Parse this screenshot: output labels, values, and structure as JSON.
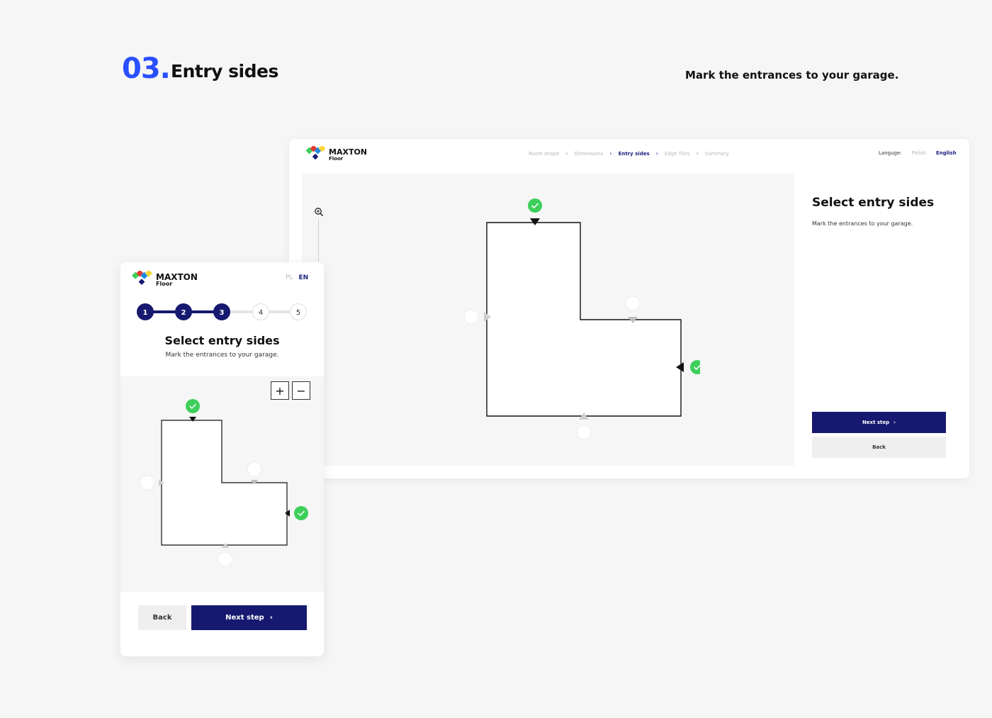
{
  "section": {
    "number": "03.",
    "title": "Entry sides",
    "subtitle": "Mark the entrances to your garage."
  },
  "brand": {
    "name": "MAXTON",
    "sub": "Floor"
  },
  "desktop": {
    "breadcrumbs": [
      {
        "label": "Room shape",
        "state": "done"
      },
      {
        "label": "Dimensions",
        "state": "done"
      },
      {
        "label": "Entry sides",
        "state": "active"
      },
      {
        "label": "Edge Tiles",
        "state": "upcoming"
      },
      {
        "label": "Summary",
        "state": "upcoming"
      }
    ],
    "language": {
      "label": "Languge:",
      "options": [
        "Polish",
        "English"
      ],
      "selected": "English"
    },
    "panel": {
      "title": "Select entry sides",
      "subtitle": "Mark the entrances to your garage.",
      "next_label": "Next step",
      "back_label": "Back"
    },
    "zoom_icon": "zoom-in-icon"
  },
  "mobile": {
    "language": {
      "options": [
        "PL",
        "EN"
      ],
      "selected": "EN"
    },
    "steps": [
      {
        "label": "1",
        "state": "complete"
      },
      {
        "label": "2",
        "state": "complete"
      },
      {
        "label": "3",
        "state": "active"
      },
      {
        "label": "4",
        "state": "upcoming"
      },
      {
        "label": "5",
        "state": "upcoming"
      }
    ],
    "title": "Select entry sides",
    "subtitle": "Mark the entrances to your garage.",
    "zoom_in_label": "+",
    "zoom_out_label": "−",
    "back_label": "Back",
    "next_label": "Next step"
  },
  "entry_sides": [
    {
      "side": "top",
      "selected": true
    },
    {
      "side": "left",
      "selected": false
    },
    {
      "side": "inner-top",
      "selected": false
    },
    {
      "side": "right",
      "selected": true
    },
    {
      "side": "bottom",
      "selected": false
    }
  ],
  "colors": {
    "accent_blue": "#2a4fff",
    "navy": "#16196f",
    "selected_green": "#3ecf5b",
    "inactive_gray": "#b8b8b8"
  }
}
